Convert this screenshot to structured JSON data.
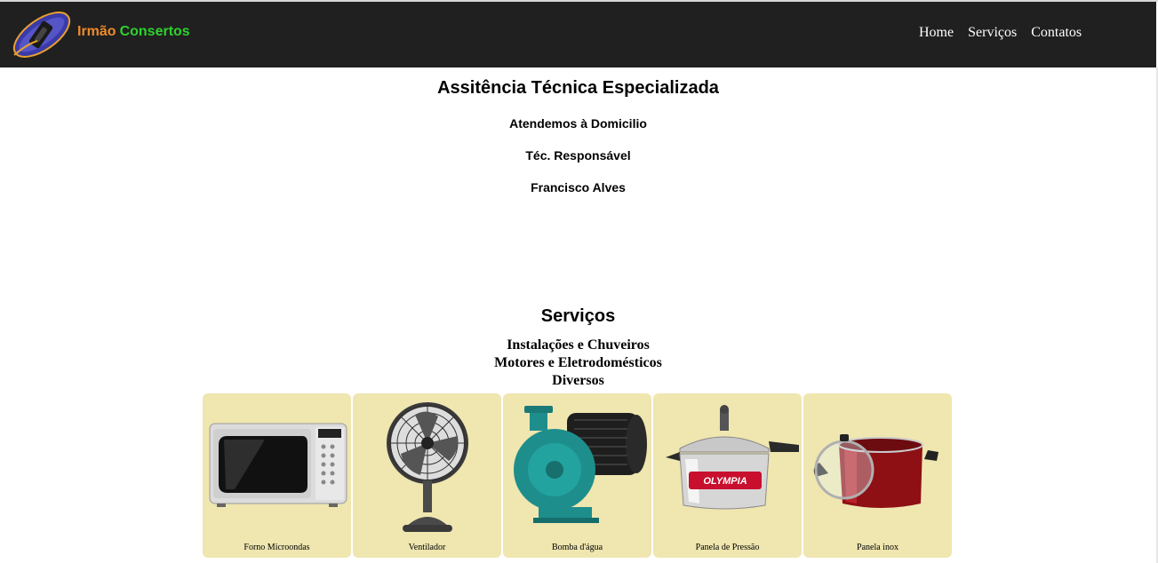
{
  "brand": {
    "part1": "Irmão",
    "part2": "Consertos"
  },
  "nav": {
    "items": [
      "Home",
      "Serviços",
      "Contatos"
    ]
  },
  "hero": {
    "title": "Assitência Técnica Especializada",
    "line1": "Atendemos à Domicilio",
    "line2": "Téc. Responsável",
    "line3": "Francisco Alves"
  },
  "services": {
    "title": "Serviços",
    "list": [
      "Instalações e Chuveiros",
      "Motores e Eletrodomésticos",
      "Diversos"
    ]
  },
  "products": [
    {
      "caption": "Forno Microondas",
      "icon": "microwave-icon"
    },
    {
      "caption": "Ventilador",
      "icon": "fan-icon"
    },
    {
      "caption": "Bomba d'água",
      "icon": "water-pump-icon"
    },
    {
      "caption": "Panela de Pressão",
      "icon": "pressure-cooker-icon",
      "label": "OLYMPIA"
    },
    {
      "caption": "Panela inox",
      "icon": "stock-pot-icon"
    }
  ],
  "colors": {
    "navbar": "#202020",
    "brand1": "#ee8a2a",
    "brand2": "#2ed12e",
    "card_bg": "#efe6b0"
  }
}
